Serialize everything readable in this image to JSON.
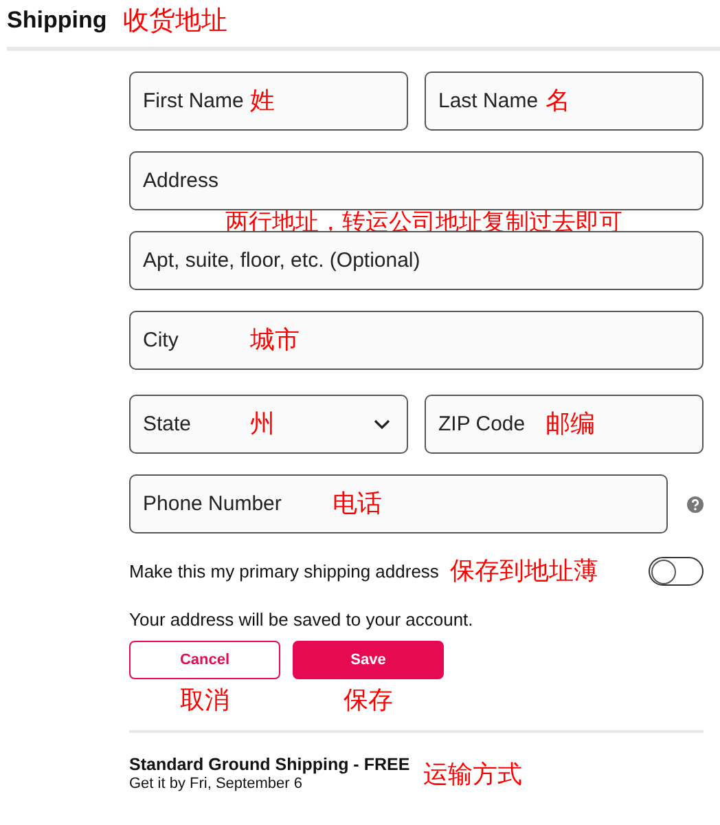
{
  "header": {
    "title": "Shipping",
    "note": "收货地址"
  },
  "rows": [
    [
      {
        "kind": "text",
        "placeholder": "First Name",
        "note": "姓"
      },
      {
        "kind": "text",
        "placeholder": "Last Name",
        "note": "名"
      }
    ],
    [
      {
        "kind": "text",
        "placeholder": "Address",
        "note_below": "两行地址，转运公司地址复制过去即可"
      }
    ],
    [
      {
        "kind": "text",
        "placeholder": "Apt, suite, floor, etc. (Optional)"
      }
    ],
    [
      {
        "kind": "text",
        "placeholder": "City",
        "note": "城市"
      }
    ],
    [
      {
        "kind": "select",
        "placeholder": "State",
        "note": "州"
      },
      {
        "kind": "text",
        "placeholder": "ZIP Code",
        "note": "邮编"
      }
    ],
    [
      {
        "kind": "text",
        "placeholder": "Phone Number",
        "note": "电话",
        "help": true
      }
    ]
  ],
  "primary": {
    "label": "Make this my primary shipping address",
    "note": "保存到地址薄",
    "on": false
  },
  "saved_notice": "Your address will be saved to your account.",
  "buttons": [
    {
      "kind": "secondary",
      "label": "Cancel",
      "note": "取消"
    },
    {
      "kind": "primary",
      "label": "Save",
      "note": "保存"
    }
  ],
  "shipping_method": {
    "title": "Standard Ground Shipping - FREE",
    "subtitle": "Get it by Fri, September 6",
    "note": "运输方式"
  }
}
